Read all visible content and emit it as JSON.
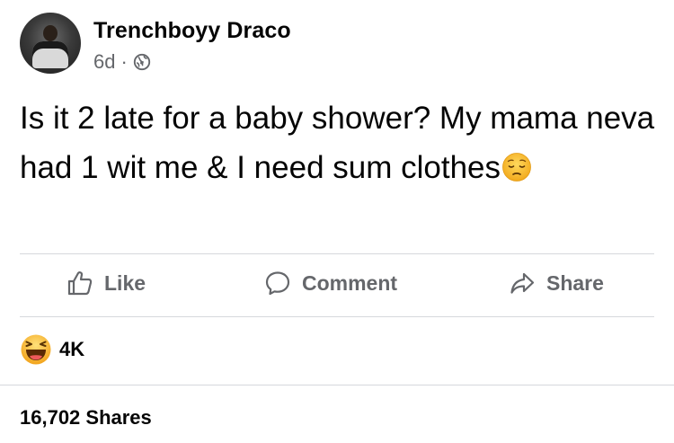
{
  "post": {
    "author": "Trenchboyy Draco",
    "time": "6d",
    "separator": "·",
    "audience_icon": "globe-icon",
    "text": "Is it 2 late for a baby shower? My mama neva had 1 wit me & I need sum clothes",
    "trailing_emoji": "pensive-face-emoji"
  },
  "actions": {
    "like_label": "Like",
    "comment_label": "Comment",
    "share_label": "Share"
  },
  "reactions": {
    "icon": "haha-reaction-icon",
    "count": "4K"
  },
  "shares": {
    "label": "16,702 Shares"
  },
  "colors": {
    "text": "#050505",
    "secondary": "#65676b",
    "divider": "#d6d8dc",
    "reaction_yellow": "#f7b125"
  }
}
